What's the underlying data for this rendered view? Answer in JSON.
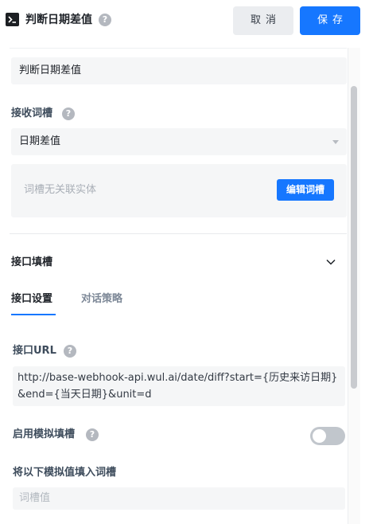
{
  "header": {
    "title": "判断日期差值",
    "help_glyph": "?",
    "cancel_label": "取消",
    "save_label": "保存"
  },
  "form": {
    "name_value": "判断日期差值",
    "slot": {
      "label": "接收词槽",
      "selected": "日期差值",
      "empty_text": "词槽无关联实体",
      "edit_button": "编辑词槽"
    },
    "interface": {
      "section_title": "接口填槽",
      "tabs": [
        {
          "label": "接口设置",
          "active": true
        },
        {
          "label": "对话策略",
          "active": false
        }
      ],
      "url_label": "接口URL",
      "url_value": "http://base-webhook-api.wul.ai/date/diff?start={历史来访日期}&end={当天日期}&unit=d",
      "mock_label": "启用模拟填槽",
      "mock_enabled": false,
      "fill_label": "将以下模拟值填入词槽",
      "fill_placeholder": "词槽值"
    }
  },
  "colors": {
    "primary": "#1677ff",
    "cancel_bg": "#ebedf0",
    "field_bg": "#f5f6f7",
    "toggle_off": "#c1c6cc"
  },
  "icons": [
    "terminal-icon",
    "help-icon",
    "caret-down-icon",
    "chevron-down-icon"
  ]
}
